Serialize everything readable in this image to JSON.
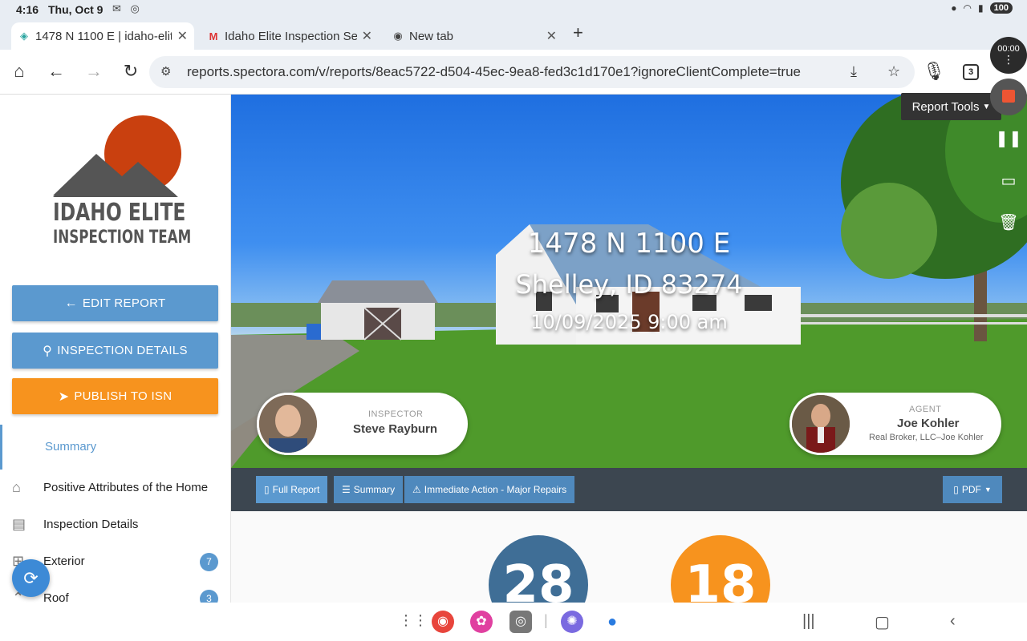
{
  "status_bar": {
    "time": "4:16",
    "date": "Thu, Oct 9",
    "battery": "100"
  },
  "tabs": [
    {
      "title": "1478 N 1100 E | idaho-elit",
      "icon": "spectora-icon",
      "active": true
    },
    {
      "title": "Idaho Elite Inspection Se",
      "icon": "gmail-icon",
      "active": false
    },
    {
      "title": "New tab",
      "icon": "chrome-icon",
      "active": false
    }
  ],
  "address_bar": {
    "url": "reports.spectora.com/v/reports/8eac5722-d504-45ec-9ea8-fed3c1d170e1?ignoreClientComplete=true",
    "tab_count": "3"
  },
  "recorder": {
    "timer": "00:00"
  },
  "sidebar": {
    "logo_line1": "IDAHO ELITE",
    "logo_line2": "INSPECTION TEAM",
    "buttons": {
      "edit": "EDIT REPORT",
      "details": "INSPECTION DETAILS",
      "publish": "PUBLISH TO ISN"
    },
    "summary_label": "Summary",
    "items": [
      {
        "label": "Positive Attributes of the Home",
        "icon": "house-icon"
      },
      {
        "label": "Inspection Details",
        "icon": "document-icon"
      },
      {
        "label": "Exterior",
        "icon": "fence-icon",
        "badge": "7"
      },
      {
        "label": "Roof",
        "icon": "roof-icon",
        "badge": "3"
      }
    ]
  },
  "hero": {
    "street": "1478 N 1100 E",
    "city": "Shelley, ID 83274",
    "datetime": "10/09/2025 9:00 am",
    "inspector": {
      "role": "INSPECTOR",
      "name": "Steve Rayburn"
    },
    "agent": {
      "role": "AGENT",
      "name": "Joe Kohler",
      "company": "Real Broker, LLC–Joe Kohler"
    },
    "report_tools": "Report Tools"
  },
  "report_bar": {
    "full_report": "Full Report",
    "summary": "Summary",
    "immediate": "Immediate Action - Major Repairs",
    "pdf": "PDF"
  },
  "stats": {
    "blue": "28",
    "orange": "18"
  },
  "colors": {
    "accent_blue": "#5b99cf",
    "accent_orange": "#f7931e",
    "stat_blue": "#3f6e96",
    "stat_orange": "#f7931e",
    "report_bar": "#3c4650"
  }
}
